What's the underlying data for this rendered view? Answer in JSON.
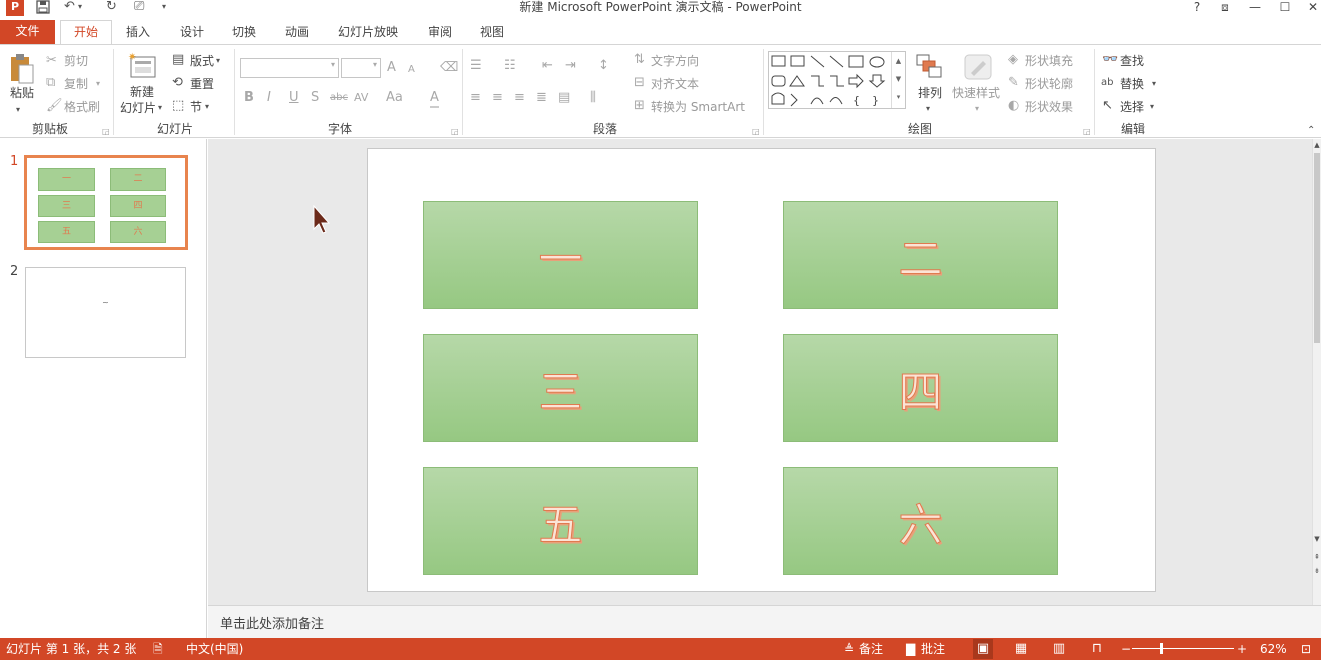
{
  "app": {
    "title": "新建 Microsoft PowerPoint 演示文稿 - PowerPoint",
    "window_controls": {
      "help": "?",
      "restore_ribbon": "⧈",
      "minimize": "—",
      "maximize": "☐",
      "close": "✕"
    }
  },
  "qat": {
    "app_icon": "P",
    "save_icon": "save-icon",
    "undo_icon": "undo-icon",
    "redo_icon": "repeat-icon",
    "present_icon": "present-icon"
  },
  "tabs": [
    "文件",
    "开始",
    "插入",
    "设计",
    "切换",
    "动画",
    "幻灯片放映",
    "审阅",
    "视图"
  ],
  "ribbon": {
    "clipboard": {
      "paste": "粘贴",
      "cut": "剪切",
      "copy": "复制",
      "format_painter": "格式刷",
      "label": "剪贴板"
    },
    "slides": {
      "new_slide_line1": "新建",
      "new_slide_line2": "幻灯片",
      "layout": "版式",
      "reset": "重置",
      "section": "节",
      "label": "幻灯片"
    },
    "font": {
      "bold": "B",
      "italic": "I",
      "underline": "U",
      "shadow": "S",
      "strike": "abc",
      "spacing": "AV",
      "case": "Aa",
      "color": "A",
      "grow": "A",
      "shrink": "A",
      "label": "字体"
    },
    "paragraph": {
      "text_direction": "文字方向",
      "align_text": "对齐文本",
      "smartart": "转换为 SmartArt",
      "label": "段落"
    },
    "drawing": {
      "arrange": "排列",
      "quick_styles": "快速样式",
      "shape_fill": "形状填充",
      "shape_outline": "形状轮廓",
      "shape_effects": "形状效果",
      "label": "绘图"
    },
    "editing": {
      "find": "查找",
      "replace": "替换",
      "select": "选择",
      "label": "编辑"
    }
  },
  "thumbnails": [
    {
      "number": "1",
      "boxes": [
        "一",
        "二",
        "三",
        "四",
        "五",
        "六"
      ]
    },
    {
      "number": "2",
      "text": "~"
    }
  ],
  "slide": {
    "boxes": [
      "一",
      "二",
      "三",
      "四",
      "五",
      "六"
    ]
  },
  "notes": {
    "placeholder": "单击此处添加备注"
  },
  "status": {
    "slide_info": "幻灯片 第 1 张，共 2 张",
    "language": "中文(中国)",
    "notes": "备注",
    "comments": "批注",
    "zoom": "62%",
    "zoom_level": 0.62
  },
  "colors": {
    "accent": "#d24726",
    "box_fill": "#a6d094",
    "glyph": "#e07a4f"
  }
}
